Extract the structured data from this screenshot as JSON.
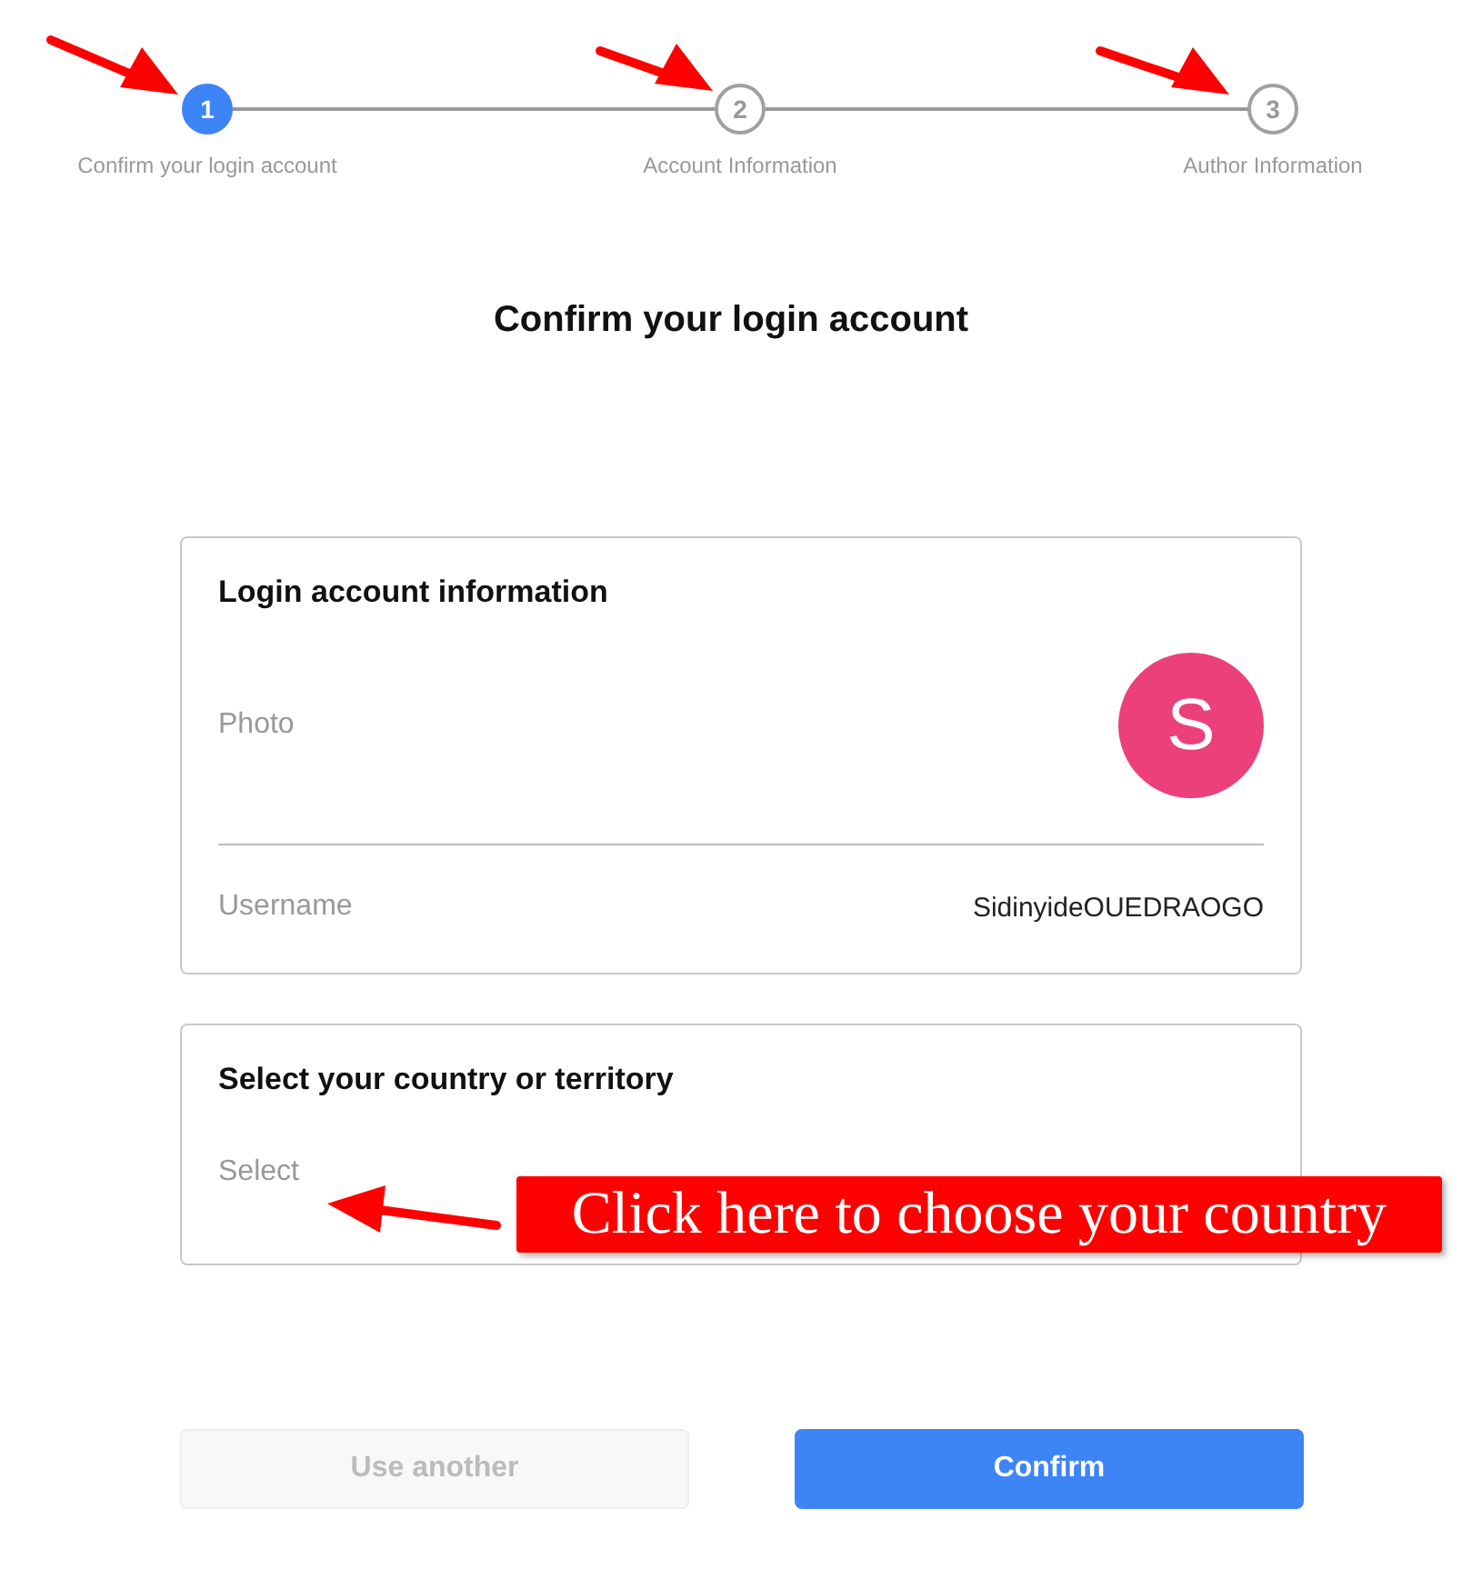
{
  "steps": [
    {
      "number": "1",
      "label": "Confirm your login account",
      "selected": true
    },
    {
      "number": "2",
      "label": "Account Information",
      "selected": false
    },
    {
      "number": "3",
      "label": "Author Information",
      "selected": false
    }
  ],
  "title": "Confirm your login account",
  "login_card": {
    "heading": "Login account information",
    "photo_label": "Photo",
    "avatar_letter": "S",
    "username_label": "Username",
    "username": "SidinyideOUEDRAOGO"
  },
  "country_card": {
    "heading": "Select your country or territory",
    "placeholder": "Select"
  },
  "callout": "Click here to choose your country",
  "buttons": [
    {
      "label": "Use another",
      "kind": "secondary",
      "disabled": true
    },
    {
      "label": "Confirm",
      "kind": "primary",
      "disabled": false
    }
  ]
}
